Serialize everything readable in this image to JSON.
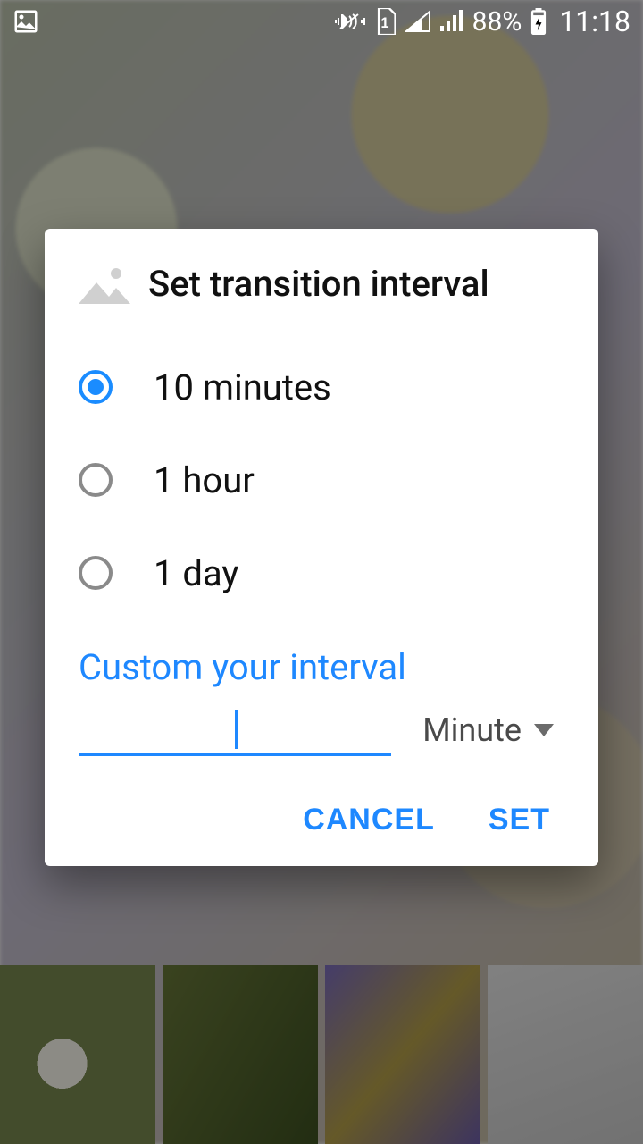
{
  "status": {
    "battery_text": "88%",
    "time": "11:18"
  },
  "dialog": {
    "title": "Set transition interval",
    "options": [
      {
        "label": "10 minutes",
        "selected": true
      },
      {
        "label": "1 hour",
        "selected": false
      },
      {
        "label": "1 day",
        "selected": false
      }
    ],
    "custom_label": "Custom your interval",
    "custom_value": "",
    "unit_selected": "Minute",
    "buttons": {
      "cancel": "CANCEL",
      "set": "SET"
    }
  }
}
